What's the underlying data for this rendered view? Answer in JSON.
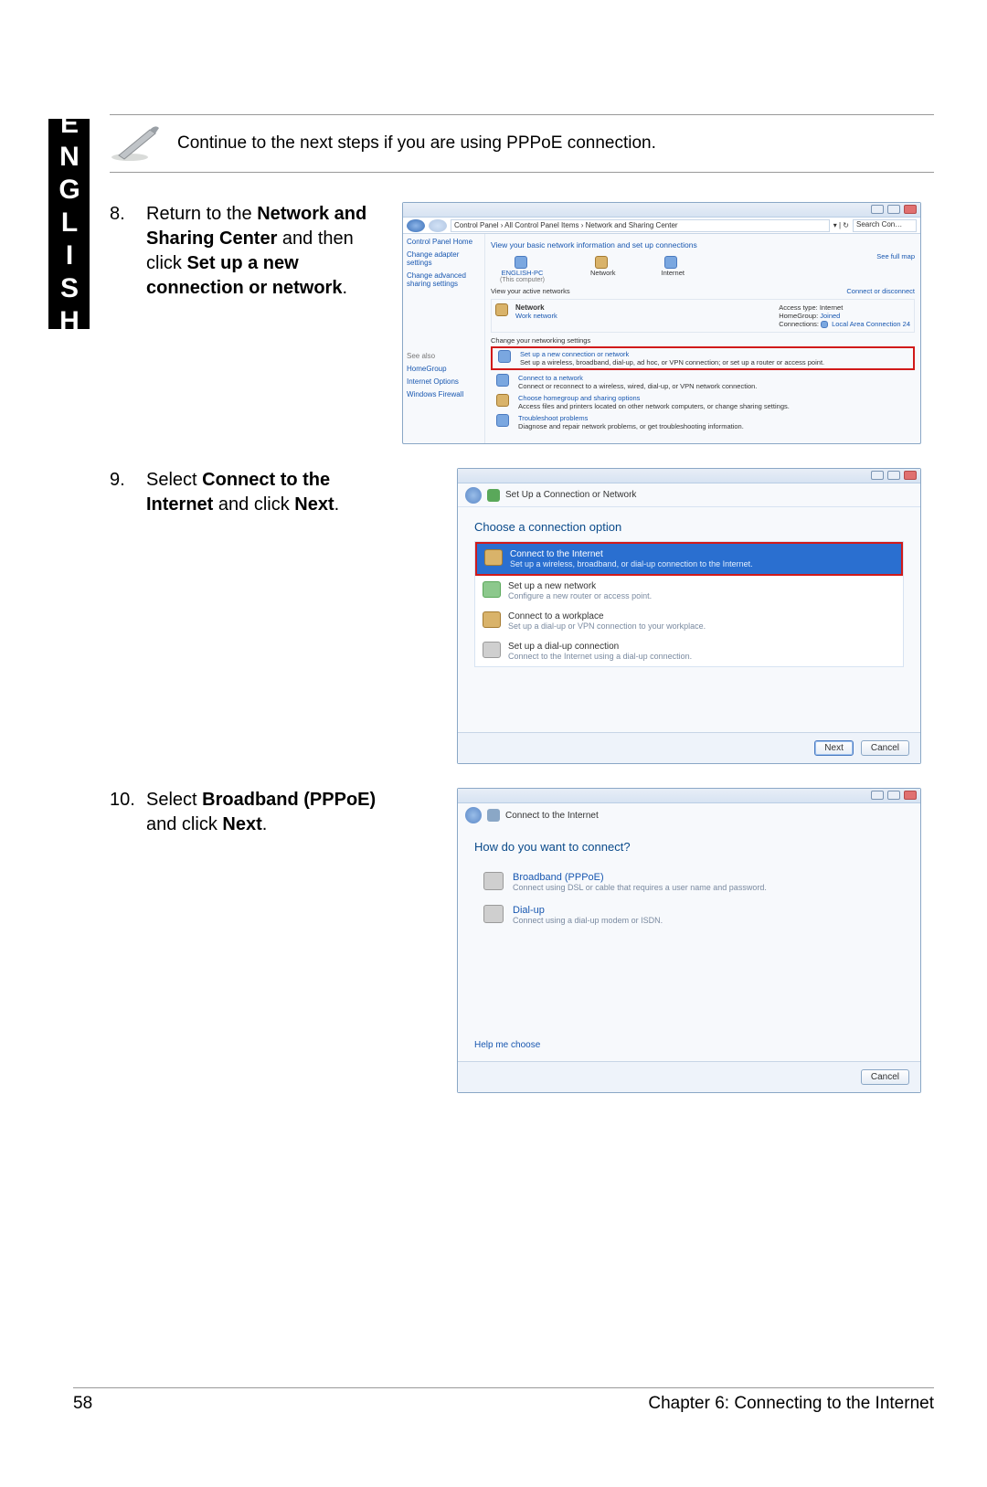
{
  "sidebar": {
    "language": "ENGLISH"
  },
  "note": {
    "text": "Continue to the next steps if you are using PPPoE connection."
  },
  "steps": {
    "8": {
      "num": "8.",
      "t1": "Return to the ",
      "b1": "Network and Sharing Center",
      "t2": " and then click ",
      "b2": "Set up a new connection or network",
      "t3": "."
    },
    "9": {
      "num": "9.",
      "t1": "Select ",
      "b1": "Connect to the Internet",
      "t2": " and click ",
      "b2": "Next",
      "t3": "."
    },
    "10": {
      "num": "10.",
      "t1": "Select ",
      "b1": "Broadband (PPPoE)",
      "t2": " and click ",
      "b2": "Next",
      "t3": "."
    }
  },
  "shot1": {
    "crumb_path": "Control Panel  ›  All Control Panel Items  ›  Network and Sharing Center",
    "crumb_search": "Search Con…",
    "side": {
      "home": "Control Panel Home",
      "adapter": "Change adapter settings",
      "advanced": "Change advanced sharing settings",
      "seealso": "See also",
      "homegroup": "HomeGroup",
      "inetopt": "Internet Options",
      "firewall": "Windows Firewall"
    },
    "title1": "View your basic network information and set up connections",
    "map_link": "See full map",
    "map_pc": "ENGLISH-PC",
    "map_pc_sub": "(This computer)",
    "map_net": "Network",
    "map_inet": "Internet",
    "active_title": "View your active networks",
    "active_connect": "Connect or disconnect",
    "net_name": "Network",
    "net_sub": "Work network",
    "net_access_l": "Access type:",
    "net_access_v": "Internet",
    "net_hg_l": "HomeGroup:",
    "net_hg_v": "Joined",
    "net_conn_l": "Connections:",
    "net_conn_v": "Local Area Connection 24",
    "change_title": "Change your networking settings",
    "opt1_t": "Set up a new connection or network",
    "opt1_s": "Set up a wireless, broadband, dial-up, ad hoc, or VPN connection; or set up a router or access point.",
    "opt2_t": "Connect to a network",
    "opt2_s": "Connect or reconnect to a wireless, wired, dial-up, or VPN network connection.",
    "opt3_t": "Choose homegroup and sharing options",
    "opt3_s": "Access files and printers located on other network computers, or change sharing settings.",
    "opt4_t": "Troubleshoot problems",
    "opt4_s": "Diagnose and repair network problems, or get troubleshooting information."
  },
  "shot2": {
    "title": "Set Up a Connection or Network",
    "prompt": "Choose a connection option",
    "r1_t": "Connect to the Internet",
    "r1_s": "Set up a wireless, broadband, or dial-up connection to the Internet.",
    "r2_t": "Set up a new network",
    "r2_s": "Configure a new router or access point.",
    "r3_t": "Connect to a workplace",
    "r3_s": "Set up a dial-up or VPN connection to your workplace.",
    "r4_t": "Set up a dial-up connection",
    "r4_s": "Connect to the Internet using a dial-up connection.",
    "next": "Next",
    "cancel": "Cancel"
  },
  "shot3": {
    "title": "Connect to the Internet",
    "prompt": "How do you want to connect?",
    "o1_t": "Broadband (PPPoE)",
    "o1_s": "Connect using DSL or cable that requires a user name and password.",
    "o2_t": "Dial-up",
    "o2_s": "Connect using a dial-up modem or ISDN.",
    "help": "Help me choose",
    "cancel": "Cancel"
  },
  "footer": {
    "page": "58",
    "chapter": "Chapter 6: Connecting to the Internet"
  }
}
